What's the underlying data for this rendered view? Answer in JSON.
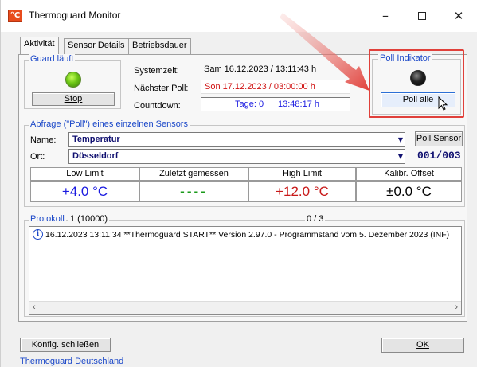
{
  "window": {
    "title": "Thermoguard Monitor",
    "app_icon_text": "°C",
    "minimize": "–",
    "close": "✕"
  },
  "tabs": [
    {
      "label": "Aktivität",
      "active": true
    },
    {
      "label": "Sensor Details",
      "active": false
    },
    {
      "label": "Betriebsdauer",
      "active": false
    }
  ],
  "guard": {
    "group_label": "Guard läuft",
    "stop_label": "Stop"
  },
  "times": {
    "systemzeit_label": "Systemzeit:",
    "systemzeit_value": "Sam 16.12.2023 / 13:11:43 h",
    "naechster_label": "Nächster Poll:",
    "naechster_value": "Son  17.12.2023 / 03:00:00 h",
    "countdown_label": "Countdown:",
    "countdown_days": "Tage: 0",
    "countdown_time": "13:48:17 h"
  },
  "poll": {
    "group_label": "Poll Indikator",
    "poll_all_label": "Poll alle"
  },
  "abfrage": {
    "group_label": "Abfrage (\"Poll\") eines einzelnen Sensors",
    "name_label": "Name:",
    "name_value": "Temperatur",
    "ort_label": "Ort:",
    "ort_value": "Düsseldorf",
    "poll_sensor_label": "Poll Sensor",
    "counter": "001/003"
  },
  "grid": {
    "headers": [
      "Low Limit",
      "Zuletzt gemessen",
      "High Limit",
      "Kalibr. Offset"
    ],
    "values": [
      "+4.0 °C",
      "----",
      "+12.0 °C",
      "±0.0 °C"
    ],
    "colors": [
      "#1a1ae0",
      "#1a9a1a",
      "#c81818",
      "#000000"
    ]
  },
  "protokoll": {
    "label": "Protokoll",
    "count": "1 (10000)",
    "position": "0 / 3",
    "entry": "16.12.2023 13:11:34  **Thermoguard START** Version 2.97.0 - Programmstand vom 5. Dezember 2023 (INF)"
  },
  "footer": {
    "konfig_label": "Konfig. schließen",
    "ok_label": "OK",
    "company": "Thermoguard Deutschland"
  },
  "colors": {
    "accent_blue": "#1a47c8",
    "highlight_red": "#e0403a"
  }
}
